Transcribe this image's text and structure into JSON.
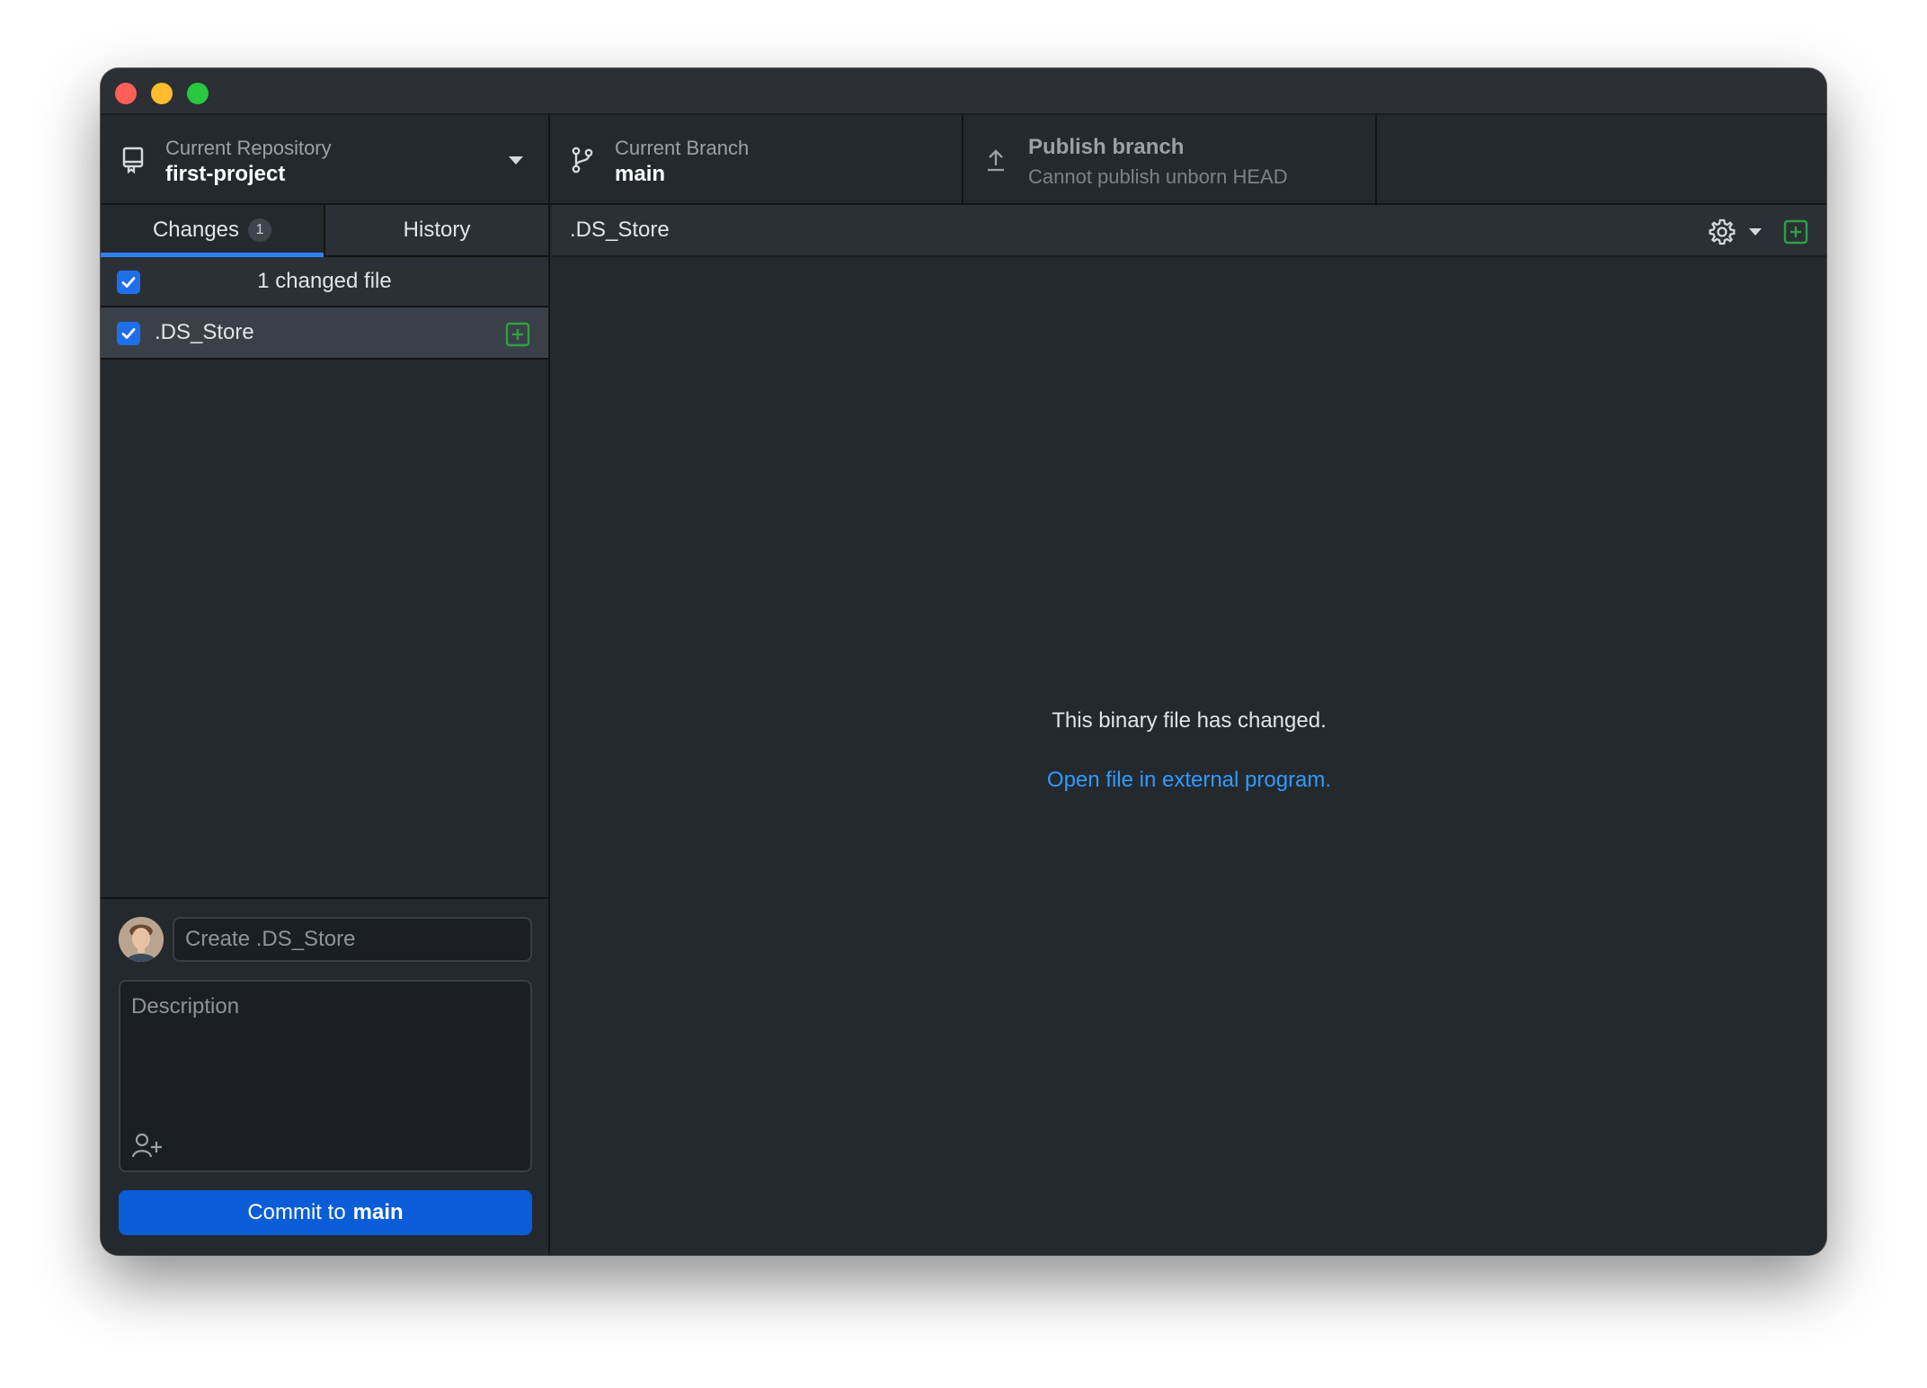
{
  "window": {
    "controls": [
      "close",
      "minimize",
      "zoom"
    ]
  },
  "toolbar": {
    "repository": {
      "label": "Current Repository",
      "value": "first-project",
      "icon": "repo-icon"
    },
    "branch": {
      "label": "Current Branch",
      "value": "main",
      "icon": "git-branch-icon"
    },
    "publish": {
      "label": "Publish branch",
      "value": "Cannot publish unborn HEAD",
      "icon": "upload-arrow-icon"
    }
  },
  "sidebar": {
    "tabs": [
      {
        "label": "Changes",
        "badge": "1",
        "active": true
      },
      {
        "label": "History",
        "active": false
      }
    ],
    "changes_header": "1 changed file",
    "files": [
      {
        "name": ".DS_Store",
        "checked": true,
        "status": "added"
      }
    ]
  },
  "commit": {
    "summary_placeholder": "Create .DS_Store",
    "description_placeholder": "Description",
    "button_prefix": "Commit to",
    "button_branch": "main"
  },
  "diff": {
    "file_name": ".DS_Store",
    "message": "This binary file has changed.",
    "link": "Open file in external program."
  },
  "colors": {
    "accent": "#1f6feb",
    "commit_button": "#0a5dd6",
    "link": "#2f9bff",
    "added": "#2ea043",
    "background": "#24292e"
  }
}
